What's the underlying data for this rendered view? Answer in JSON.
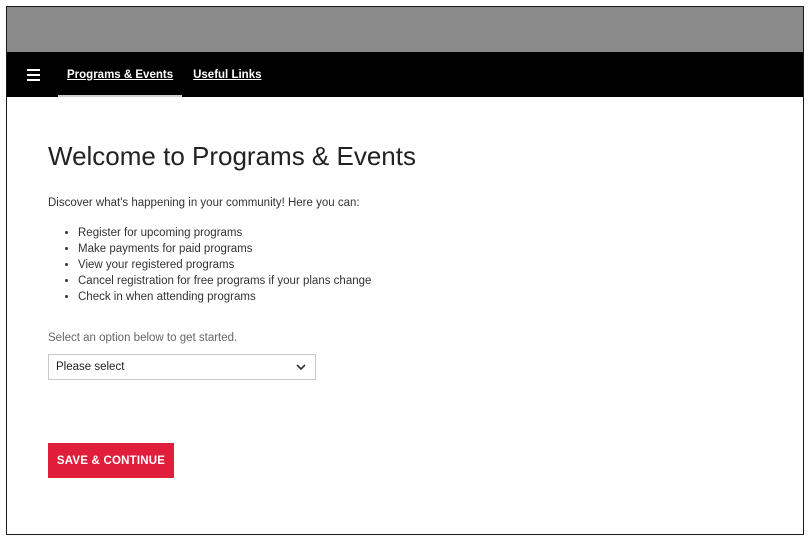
{
  "nav": {
    "menu_icon": "hamburger-menu-icon",
    "links": [
      {
        "label": "Programs & Events",
        "active": true
      },
      {
        "label": "Useful Links",
        "active": false
      }
    ]
  },
  "main": {
    "title": "Welcome to Programs & Events",
    "intro": "Discover what's happening in your community! Here you can:",
    "features": [
      "Register for upcoming programs",
      "Make payments for paid programs",
      "View your registered programs",
      "Cancel registration for free programs if your plans change",
      "Check in when attending programs"
    ],
    "prompt": "Select an option below to get started.",
    "select": {
      "value": "Please select",
      "icon": "chevron-down-icon"
    },
    "save_label": "SAVE & CONTINUE"
  },
  "colors": {
    "top_strip": "#8a8a8a",
    "navbar": "#000000",
    "accent": "#e01e3c"
  }
}
